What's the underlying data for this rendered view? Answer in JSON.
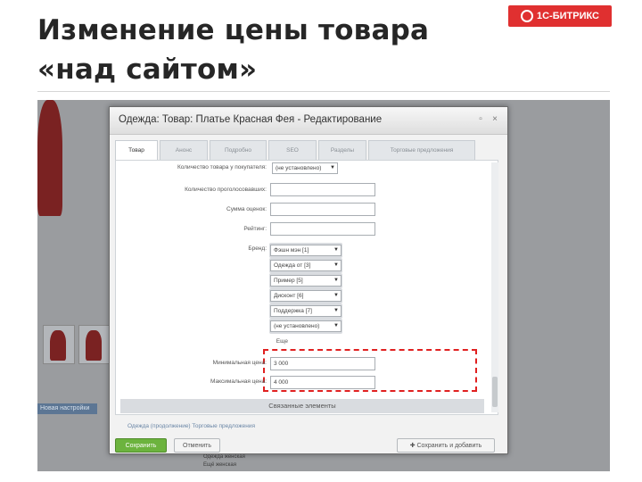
{
  "slide": {
    "title": "Изменение цены товара «над сайтом»",
    "logo_text": "1С-БИТРИКС"
  },
  "background": {
    "side_link": "Новая настройки"
  },
  "dialog": {
    "title": "Одежда: Товар: Платье Красная Фея - Редактирование",
    "tabs": [
      {
        "label": "Товар",
        "active": true
      },
      {
        "label": "Анонс",
        "active": false
      },
      {
        "label": "Подробно",
        "active": false
      },
      {
        "label": "SEO",
        "active": false
      },
      {
        "label": "Разделы",
        "active": false
      },
      {
        "label": "Торговые предложения",
        "active": false
      }
    ],
    "fields": [
      {
        "label": "Количество товара у покупателя:",
        "value": "(не установлено)",
        "kind": "select"
      },
      {
        "label": "Количество проголосовавших:",
        "value": "",
        "kind": "input"
      },
      {
        "label": "Сумма оценок:",
        "value": "",
        "kind": "input"
      },
      {
        "label": "Рейтинг:",
        "value": "",
        "kind": "input"
      }
    ],
    "brand_label": "Бренд:",
    "brand_options": [
      "Фэшн мэн [1]",
      "Одежда от [3]",
      "Пример [5]",
      "Дисконт [6]",
      "Поддержка [7]",
      "(не установлено)"
    ],
    "caption_under_brands": "Еще",
    "min_price_label": "Минимальная цена:",
    "min_price_value": "3 000",
    "max_price_label": "Максимальная цена:",
    "max_price_value": "4 000",
    "section_bar": "Связанные элементы",
    "footer_link": "Одежда (продолжение) Торговые предложения",
    "buttons": {
      "save": "Сохранить",
      "cancel": "Отменить",
      "save_add": "Сохранить и добавить"
    }
  },
  "bottom_list": [
    "Одежда женская",
    "Ещё женская"
  ],
  "colors": {
    "logo": "#e03030",
    "highlight": "#e02020",
    "save_button": "#6cb33e"
  }
}
